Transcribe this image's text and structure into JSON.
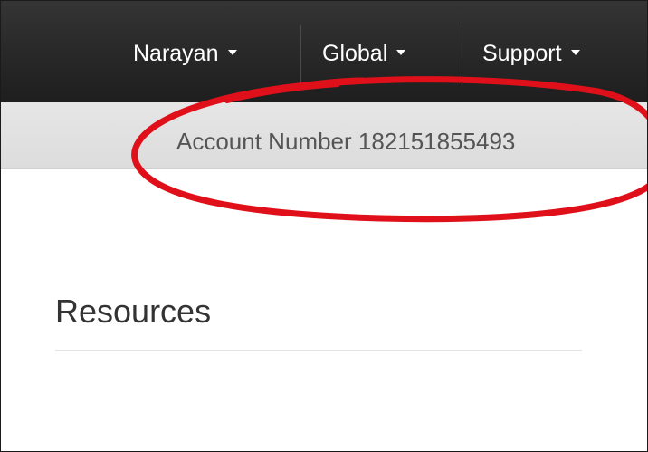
{
  "nav": {
    "items": [
      {
        "label": "Narayan",
        "icon": "chevron-down-icon"
      },
      {
        "label": "Global",
        "icon": "chevron-down-icon"
      },
      {
        "label": "Support",
        "icon": "chevron-down-icon"
      }
    ]
  },
  "account": {
    "text": "Account Number 182151855493"
  },
  "annotation": {
    "color": "#e0101a",
    "shape": "ellipse"
  },
  "main": {
    "section_title": "Resources"
  },
  "colors": {
    "topbar": "#262626",
    "account_bar": "#e2e2e2",
    "text": "#333333"
  }
}
